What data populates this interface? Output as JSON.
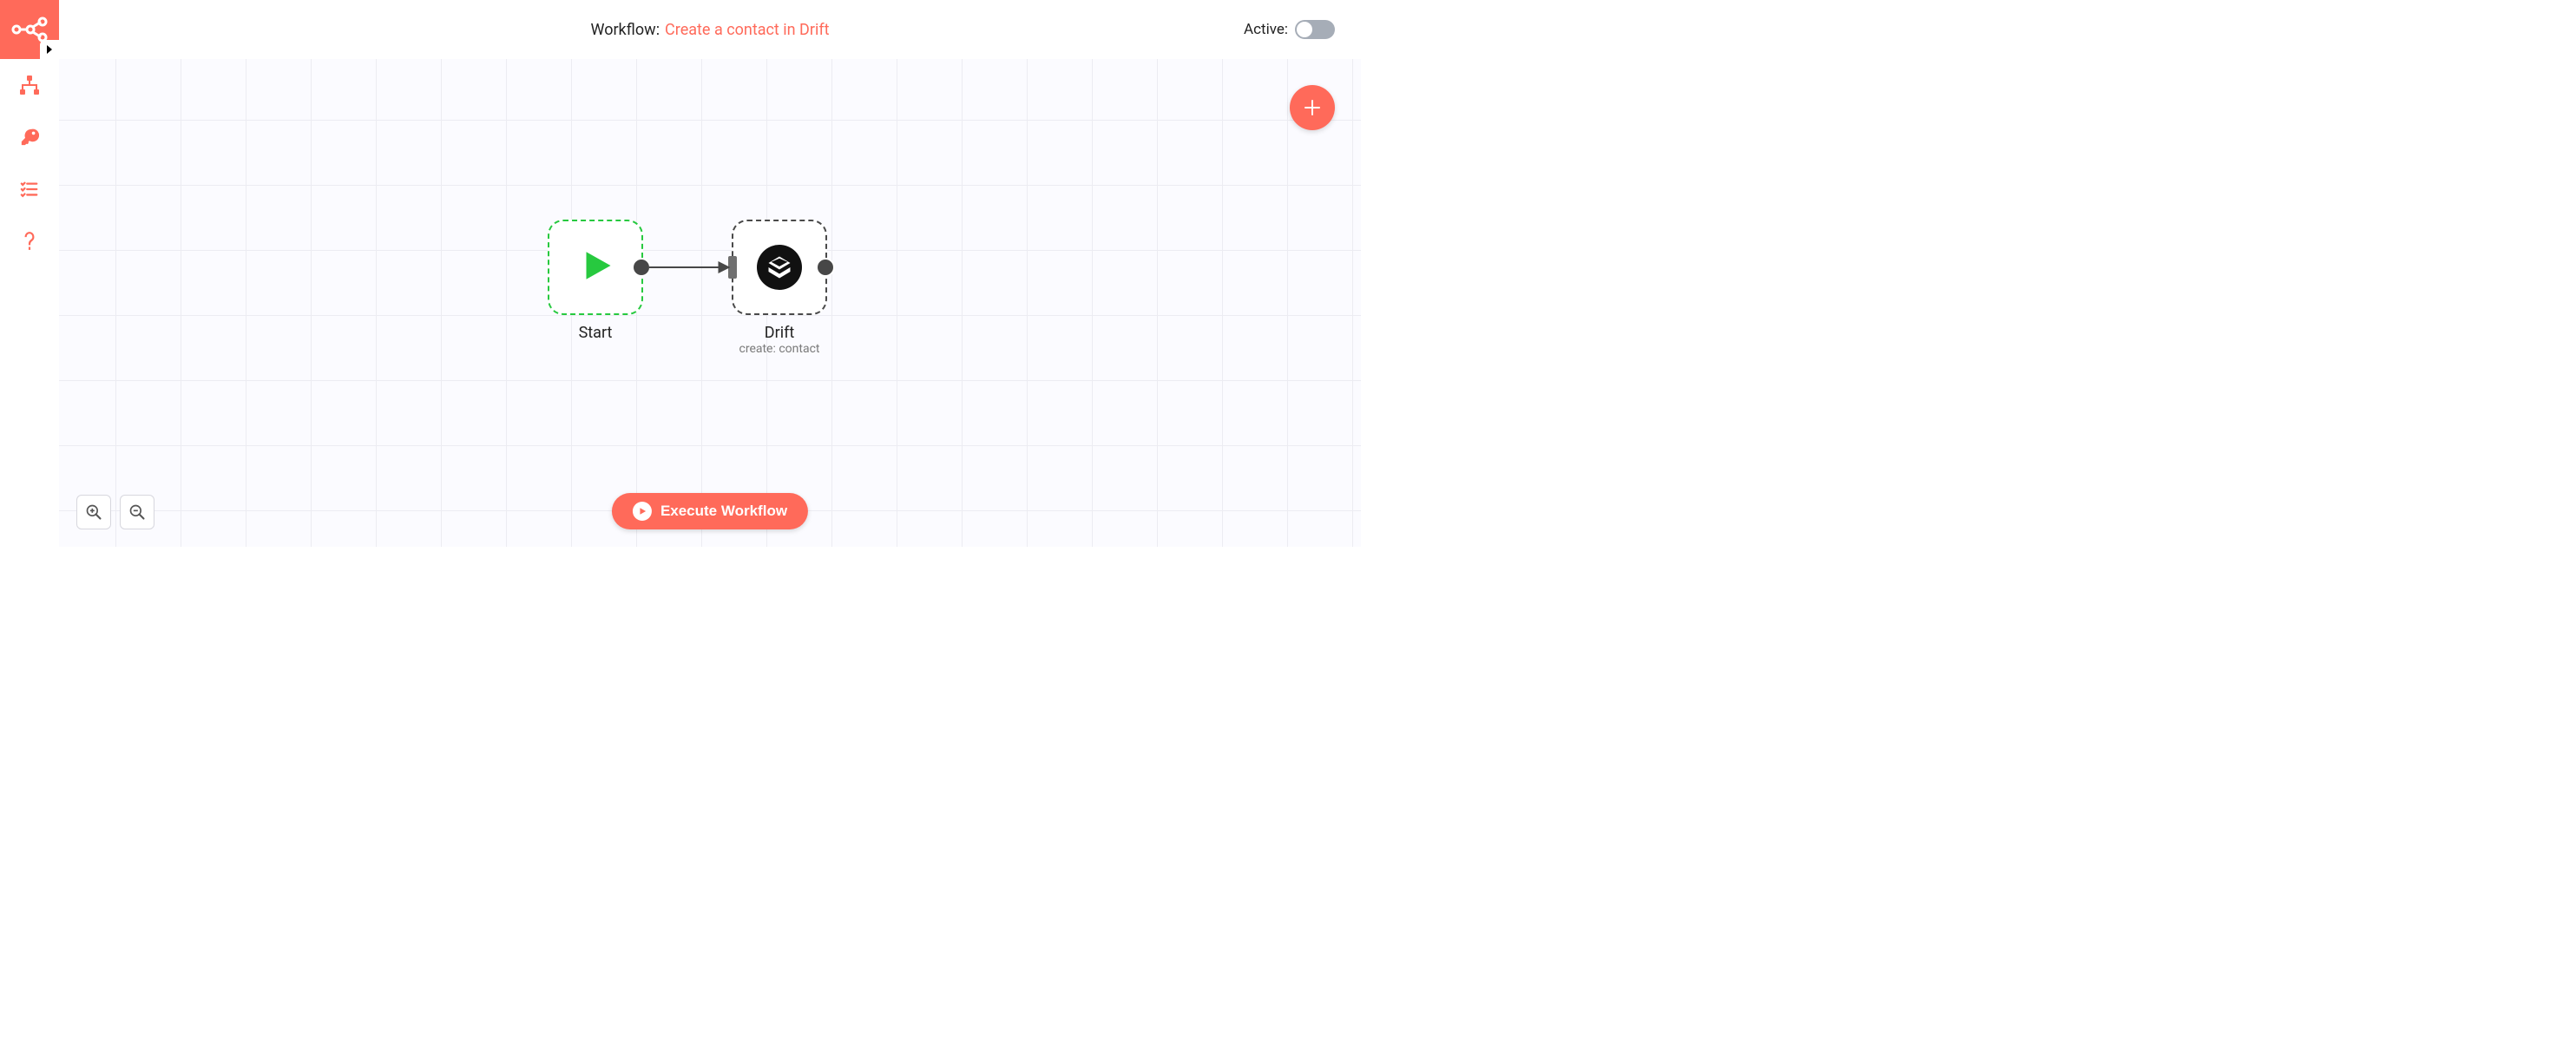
{
  "header": {
    "title_prefix": "Workflow:",
    "title_name": "Create a contact in Drift",
    "active_label": "Active:"
  },
  "sidebar": {
    "items": [
      "workflows",
      "credentials",
      "executions",
      "help"
    ]
  },
  "canvas": {
    "execute_label": "Execute Workflow"
  },
  "nodes": {
    "start": {
      "title": "Start"
    },
    "drift": {
      "title": "Drift",
      "sub": "create: contact"
    }
  },
  "colors": {
    "accent": "#ff6a5a",
    "success": "#27c93f"
  }
}
